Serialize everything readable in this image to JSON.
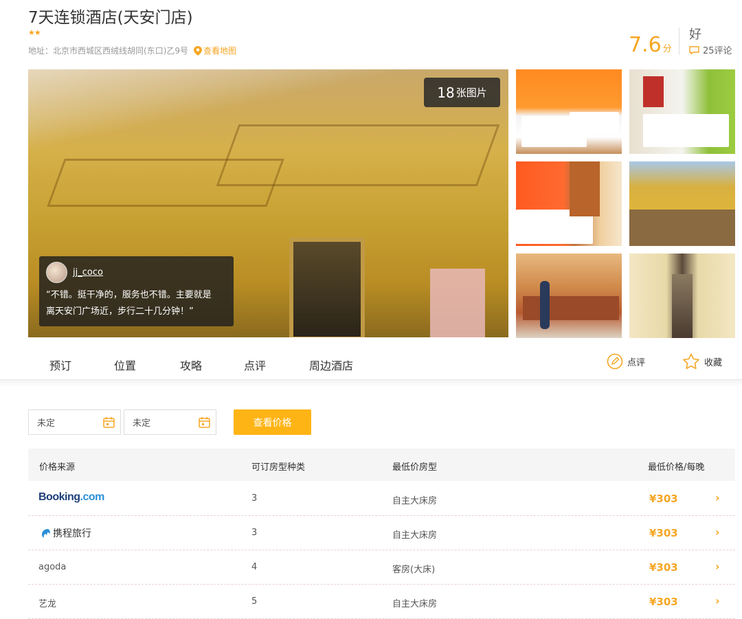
{
  "hotel": {
    "name": "7天连锁酒店(天安门店)",
    "stars": "★★",
    "address_label": "地址：",
    "address": "北京市西城区西绒线胡同(东口)乙9号",
    "map_link": "查看地图",
    "score": "7.6",
    "score_unit": "分",
    "rating_word": "好",
    "review_count": "25评论"
  },
  "gallery": {
    "photo_count_num": "18",
    "photo_count_label": "张图片",
    "featured_review": {
      "username": "jj_coco",
      "text_line1": "“不错。挺干净的，服务也不错。主要就是",
      "text_line2": "离天安门广场近，步行二十几分钟！”"
    }
  },
  "tabs": [
    {
      "label": "预订"
    },
    {
      "label": "位置"
    },
    {
      "label": "攻略"
    },
    {
      "label": "点评"
    },
    {
      "label": "周边酒店"
    }
  ],
  "actions": {
    "review": "点评",
    "favorite": "收藏"
  },
  "search": {
    "checkin": "未定",
    "checkout": "未定",
    "button": "查看价格"
  },
  "table": {
    "headers": {
      "source": "价格来源",
      "room_types": "可订房型种类",
      "cheapest_room": "最低价房型",
      "lowest_price": "最低价格/每晚"
    },
    "rows": [
      {
        "source": "Booking.com",
        "source_main": "Booking",
        "source_suffix": ".com",
        "count": "3",
        "room": "自主大床房",
        "price": "¥303"
      },
      {
        "source": "携程旅行",
        "count": "3",
        "room": "自主大床房",
        "price": "¥303"
      },
      {
        "source": "agoda",
        "count": "4",
        "room": "客房(大床)",
        "price": "¥303"
      },
      {
        "source": "艺龙",
        "count": "5",
        "room": "自主大床房",
        "price": "¥303"
      }
    ]
  },
  "colors": {
    "accent": "#f5a623",
    "button": "#ffb415"
  }
}
